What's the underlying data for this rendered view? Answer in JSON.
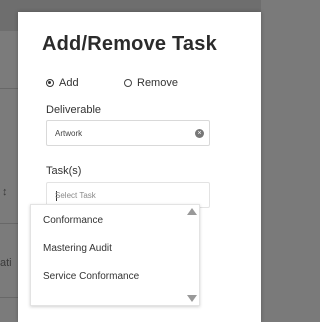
{
  "background": {
    "side_text": "ati",
    "sort_glyph": "↕"
  },
  "modal": {
    "title": "Add/Remove Task",
    "mode": {
      "add_label": "Add",
      "remove_label": "Remove",
      "selected": "Add"
    },
    "deliverable": {
      "label": "Deliverable",
      "value": "Artwork",
      "clear_glyph": "×"
    },
    "tasks": {
      "label": "Task(s)",
      "placeholder": "Select Task",
      "options": [
        "Conformance",
        "Mastering Audit",
        "Service Conformance"
      ]
    }
  }
}
